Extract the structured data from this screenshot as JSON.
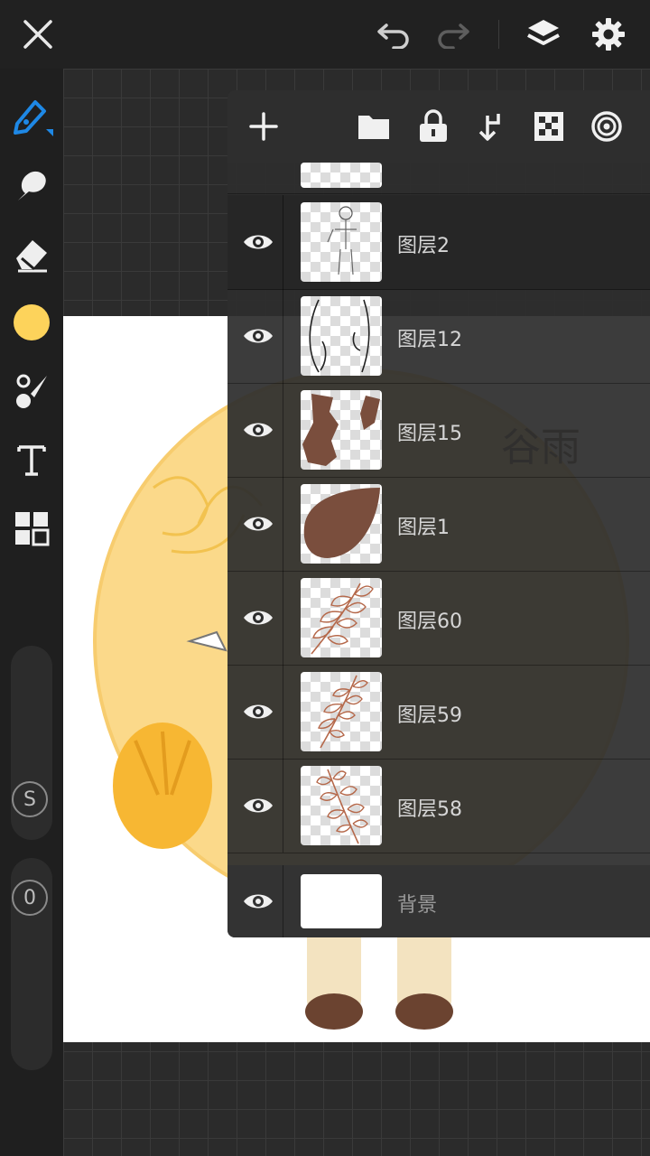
{
  "icons": {
    "close": "close-icon",
    "undo": "undo-icon",
    "redo": "redo-icon",
    "layers": "layers-icon",
    "settings": "gear-icon",
    "pen": "pen-icon",
    "smudge": "smudge-icon",
    "eraser": "eraser-icon",
    "brush": "brush-icon",
    "text": "text-icon",
    "grid": "grid-icon"
  },
  "colors": {
    "accent": "#1e88e5",
    "current_color": "#fdd35b",
    "panel_bg": "#2d2d2d",
    "topbar_bg": "#212121"
  },
  "sidebar": {
    "slider_s_label": "S",
    "slider_o_label": "0"
  },
  "layers_panel": {
    "toolbar": [
      "add-icon",
      "folder-icon",
      "lock-icon",
      "merge-down-icon",
      "checker-icon",
      "target-icon"
    ],
    "layers": [
      {
        "name": "图层2",
        "visible": true,
        "selected": true
      },
      {
        "name": "图层12",
        "visible": true,
        "selected": false
      },
      {
        "name": "图层15",
        "visible": true,
        "selected": false
      },
      {
        "name": "图层1",
        "visible": true,
        "selected": false
      },
      {
        "name": "图层60",
        "visible": true,
        "selected": false
      },
      {
        "name": "图层59",
        "visible": true,
        "selected": false
      },
      {
        "name": "图层58",
        "visible": true,
        "selected": false
      }
    ],
    "background_layer": {
      "name": "背景",
      "visible": true
    }
  },
  "canvas_art": {
    "watermark_text": "谷雨"
  }
}
